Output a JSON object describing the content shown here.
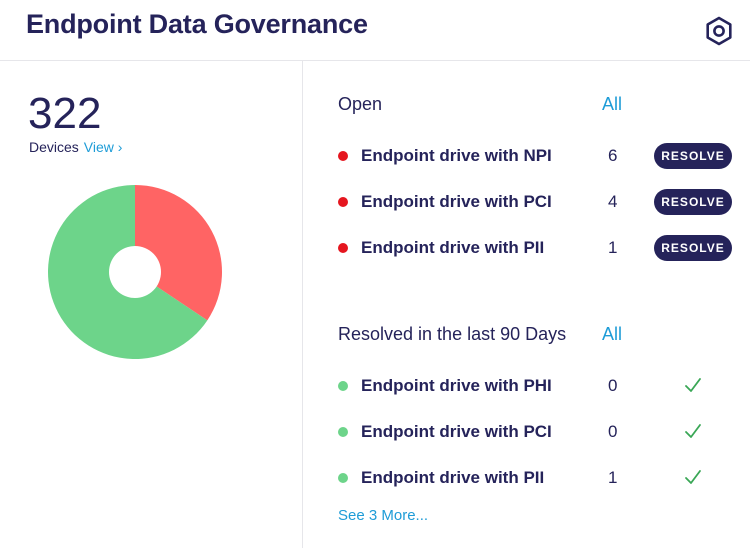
{
  "header": {
    "title": "Endpoint Data Governance",
    "settings_icon": "hexagon-gear-icon"
  },
  "summary": {
    "count": "322",
    "devices_label": "Devices",
    "view_link": "View ›"
  },
  "chart_data": {
    "type": "pie",
    "categories": [
      "Open",
      "Resolved"
    ],
    "values": [
      11,
      21
    ],
    "colors": [
      "#ff6464",
      "#6dd48a"
    ],
    "donut": true
  },
  "open": {
    "title": "Open",
    "all_link": "All",
    "items": [
      {
        "label": "Endpoint drive with NPI",
        "count": "6",
        "action": "RESOLVE"
      },
      {
        "label": "Endpoint drive with PCI",
        "count": "4",
        "action": "RESOLVE"
      },
      {
        "label": "Endpoint drive with PII",
        "count": "1",
        "action": "RESOLVE"
      }
    ]
  },
  "resolved": {
    "title": "Resolved in the last 90 Days",
    "all_link": "All",
    "items": [
      {
        "label": "Endpoint drive with PHI",
        "count": "0"
      },
      {
        "label": "Endpoint drive with PCI",
        "count": "0"
      },
      {
        "label": "Endpoint drive with PII",
        "count": "1"
      }
    ],
    "see_more": "See 3 More..."
  },
  "colors": {
    "navy": "#25235a",
    "link": "#1e9cd7",
    "open_dot": "#e5161f",
    "resolved_dot": "#6dd48a",
    "check": "#3aa756"
  }
}
